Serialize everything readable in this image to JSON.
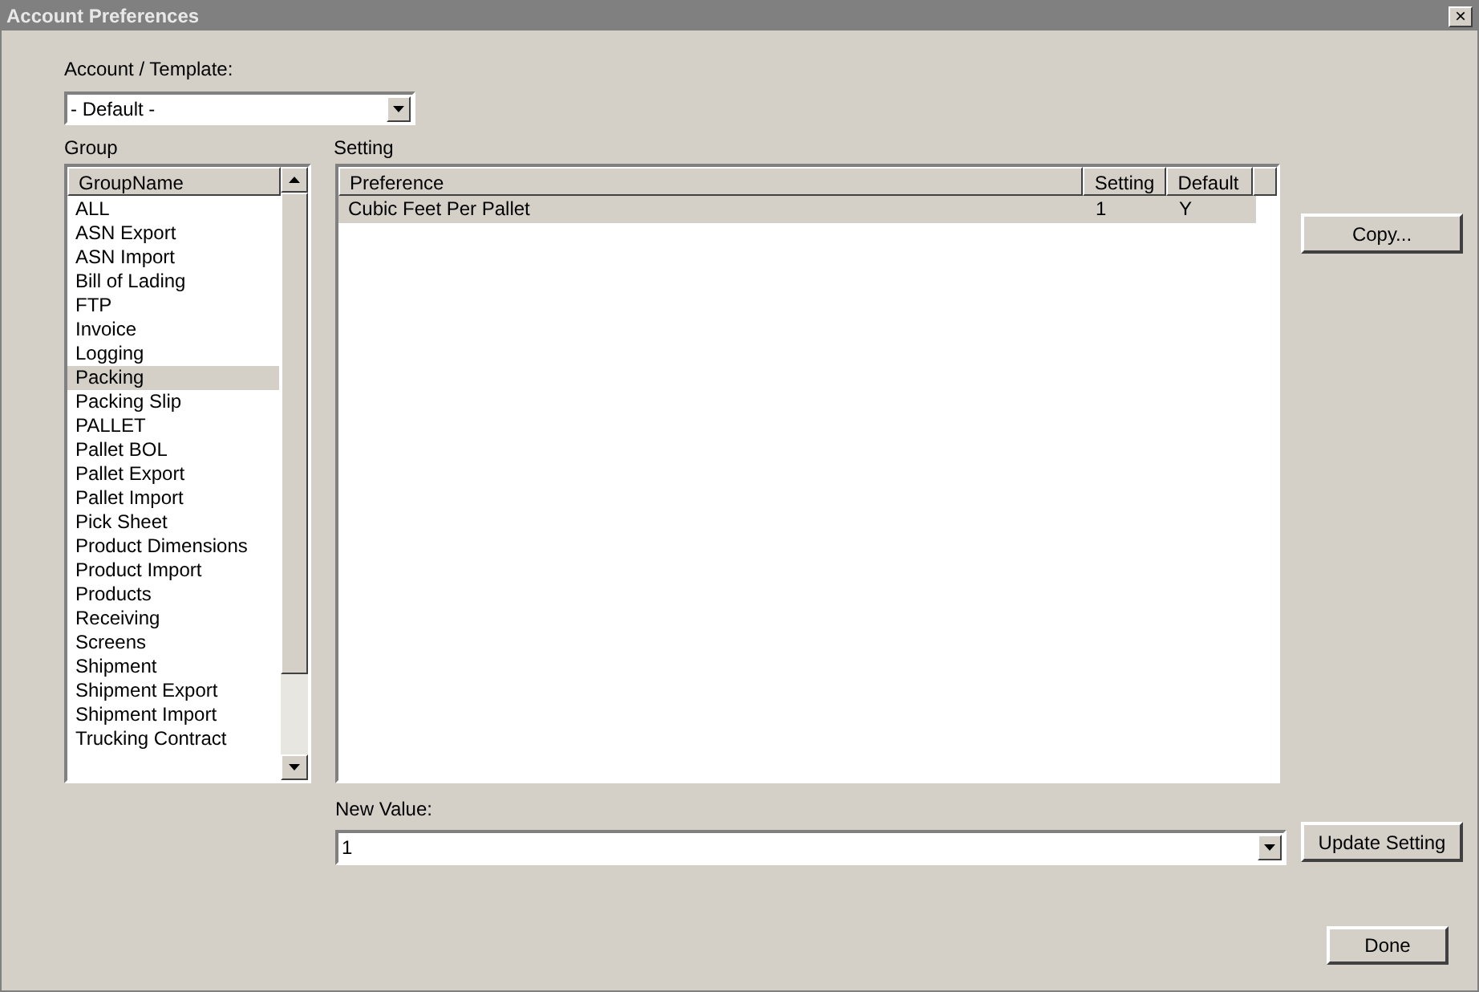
{
  "window": {
    "title": "Account Preferences",
    "close": "×"
  },
  "account": {
    "label": "Account / Template:",
    "value": "- Default -"
  },
  "group": {
    "label": "Group",
    "column": "GroupName",
    "items": [
      {
        "name": "ALL",
        "selected": false
      },
      {
        "name": "ASN Export",
        "selected": false
      },
      {
        "name": "ASN Import",
        "selected": false
      },
      {
        "name": "Bill of Lading",
        "selected": false
      },
      {
        "name": "FTP",
        "selected": false
      },
      {
        "name": "Invoice",
        "selected": false
      },
      {
        "name": "Logging",
        "selected": false
      },
      {
        "name": "Packing",
        "selected": true
      },
      {
        "name": "Packing Slip",
        "selected": false
      },
      {
        "name": "PALLET",
        "selected": false
      },
      {
        "name": "Pallet BOL",
        "selected": false
      },
      {
        "name": "Pallet Export",
        "selected": false
      },
      {
        "name": "Pallet Import",
        "selected": false
      },
      {
        "name": "Pick Sheet",
        "selected": false
      },
      {
        "name": "Product Dimensions",
        "selected": false
      },
      {
        "name": "Product Import",
        "selected": false
      },
      {
        "name": "Products",
        "selected": false
      },
      {
        "name": "Receiving",
        "selected": false
      },
      {
        "name": "Screens",
        "selected": false
      },
      {
        "name": "Shipment",
        "selected": false
      },
      {
        "name": "Shipment Export",
        "selected": false
      },
      {
        "name": "Shipment Import",
        "selected": false
      },
      {
        "name": "Trucking Contract",
        "selected": false
      }
    ]
  },
  "setting": {
    "label": "Setting",
    "columns": [
      "Preference",
      "Setting",
      "Default"
    ],
    "rows": [
      {
        "cells": [
          "Cubic Feet Per Pallet",
          "1",
          "Y"
        ],
        "selected": true
      }
    ]
  },
  "new_value": {
    "label": "New Value:",
    "value": "1"
  },
  "buttons": {
    "copy": "Copy...",
    "update": "Update Setting",
    "done": "Done"
  }
}
